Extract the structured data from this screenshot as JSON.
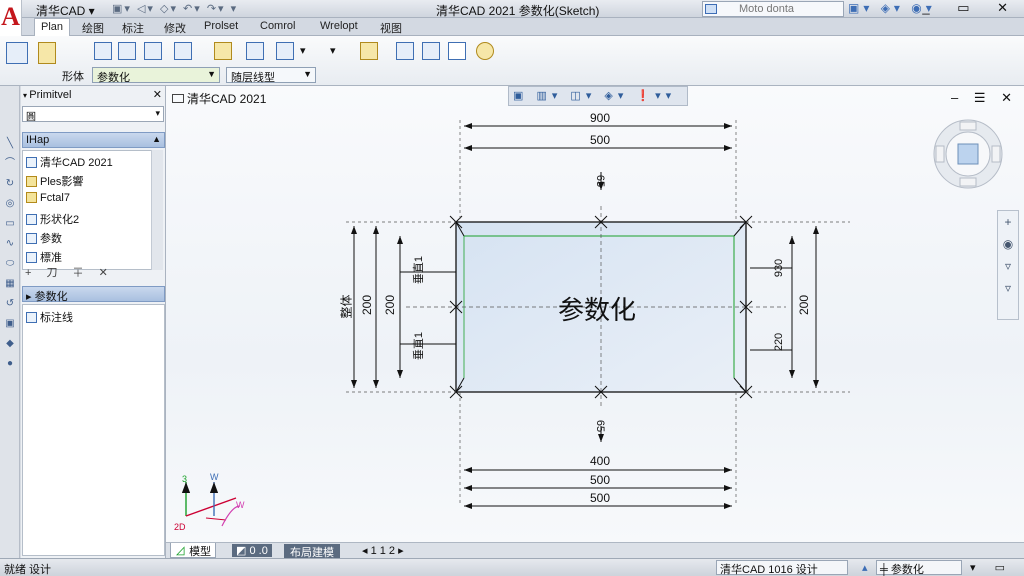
{
  "titlebar": {
    "app_name": "清华CAD ▾",
    "quick_access": "▣▾ ◁▾ ◇▾ ↶▾ ↷▾ ▾",
    "title": "清华CAD 2021 参数化(Sketch)",
    "search_placeholder": "Moto donta",
    "window_controls": "_ ▭ ✕"
  },
  "ribbon": {
    "tabs": [
      "Plan",
      "绘图",
      "标注",
      "修改",
      "Prolset",
      "Comrol",
      "Wrelopt",
      "视图"
    ],
    "group1_label": "形体",
    "layer_combo": "参数化",
    "linetype_combo": "随层线型",
    "dropdown_arrow": "▾"
  },
  "palette": {
    "title": "Primitvel",
    "close": "✕",
    "filter_value": "圓",
    "section1": "IHap",
    "items": [
      "清华CAD 2021",
      "Ples影響",
      "Fctal7",
      "形状化2",
      "参数",
      "標准"
    ],
    "footer_buttons": "+ 刀 ∓ ✕",
    "section2": "▸ 参数化",
    "prop_item": "标注线"
  },
  "canvas": {
    "doc_title": "清华CAD 2021",
    "controls": "– ☰ ✕",
    "shape_label": "参数化",
    "dims": {
      "top_outer": "900",
      "top_inner": "500",
      "bottom_1": "400",
      "bottom_2": "500",
      "bottom_3": "500",
      "left_outer": "200",
      "left_inner": "200",
      "left_label_1": "整体",
      "left_label_2": "垂直1",
      "left_label_3": "垂直1",
      "right_outer": "200",
      "right_1": "930",
      "right_2": "220",
      "top_small": "65",
      "bottom_small": "65"
    },
    "ucs": {
      "x": "W",
      "y": "3",
      "z": "W",
      "origin": "2D"
    },
    "navbar": [
      "+",
      "◉",
      "▿",
      "▿"
    ]
  },
  "layout_tabs": {
    "model": "模型",
    "layout1": "0 .0",
    "layout2": "布局建模",
    "nav": "◂ 1 1 2 ▸"
  },
  "status": {
    "left_text": "就绪 设计",
    "coords": "清华CAD 1016 设计",
    "mode": "参数化"
  },
  "colors": {
    "accent": "#3d6db5",
    "brand": "#c4161c",
    "green": "#1aa02a"
  }
}
